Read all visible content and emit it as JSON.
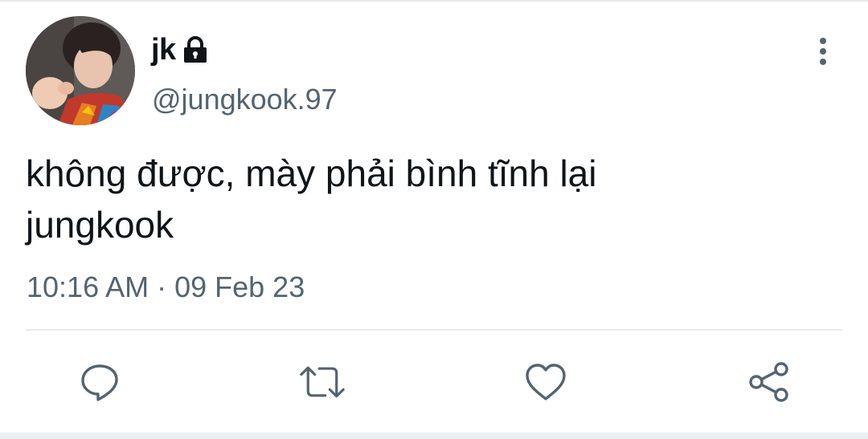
{
  "tweet": {
    "display_name": "jk",
    "protected_icon": "lock-icon",
    "handle": "@jungkook.97",
    "text_lines": [
      "không được, mày phải bình tĩnh lại",
      "jungkook"
    ],
    "timestamp": "10:16 AM · 09 Feb 23"
  },
  "actions": {
    "reply_icon": "reply-icon",
    "retweet_icon": "retweet-icon",
    "like_icon": "heart-icon",
    "share_icon": "share-icon",
    "more_icon": "more-vertical-icon"
  },
  "colors": {
    "primary_text": "#0f1419",
    "secondary_text": "#536471",
    "divider": "#e7e9ea"
  }
}
